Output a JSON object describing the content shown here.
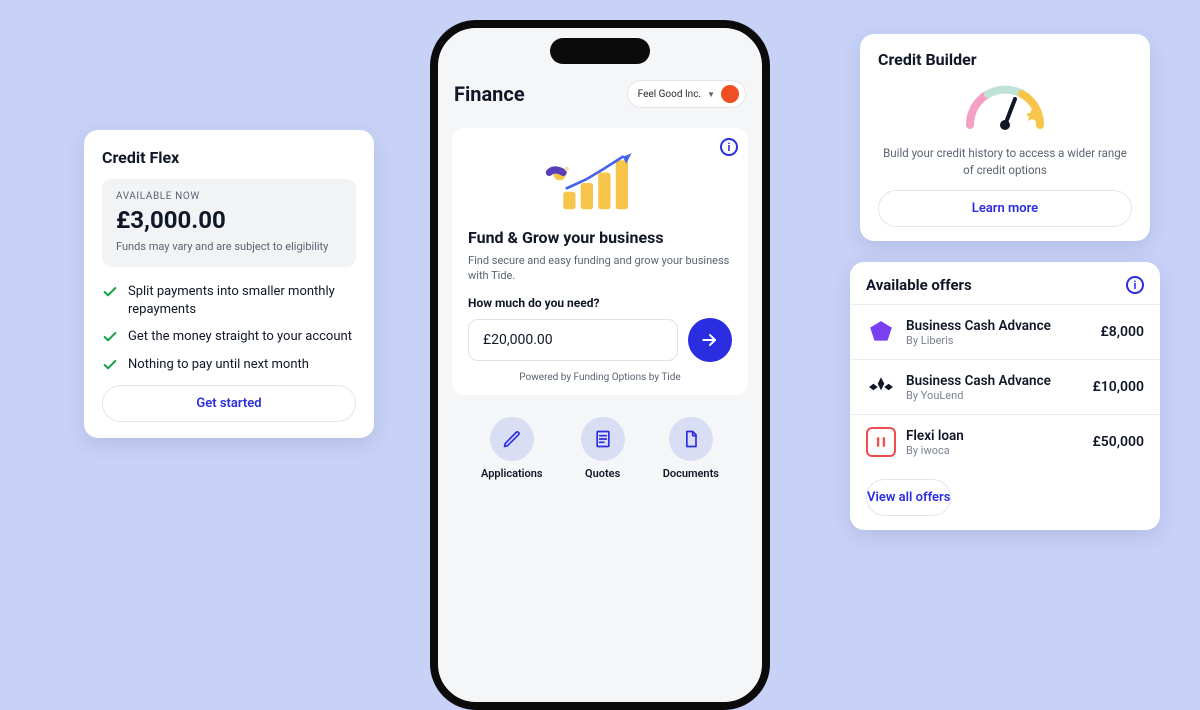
{
  "credit_flex": {
    "title": "Credit Flex",
    "available_label": "AVAILABLE NOW",
    "amount": "£3,000.00",
    "disclaimer": "Funds may vary and are subject to eligibility",
    "features": [
      "Split payments into smaller monthly repayments",
      "Get the money straight to your account",
      "Nothing to pay until next month"
    ],
    "cta": "Get started"
  },
  "phone": {
    "header_title": "Finance",
    "org_name": "Feel Good Inc.",
    "hero_title": "Fund & Grow your business",
    "hero_sub": "Find secure and easy funding and grow your business with Tide.",
    "question": "How much do you need?",
    "amount_value": "£20,000.00",
    "powered": "Powered by Funding Options by Tide",
    "actions": [
      {
        "label": "Applications",
        "icon": "pencil-icon"
      },
      {
        "label": "Quotes",
        "icon": "receipt-icon"
      },
      {
        "label": "Documents",
        "icon": "document-icon"
      }
    ]
  },
  "credit_builder": {
    "title": "Credit Builder",
    "desc": "Build your credit history to access a wider range of credit options",
    "cta": "Learn more"
  },
  "offers": {
    "title": "Available offers",
    "items": [
      {
        "name": "Business Cash Advance",
        "by": "By Liberis",
        "amount": "£8,000"
      },
      {
        "name": "Business Cash Advance",
        "by": "By YouLend",
        "amount": "£10,000"
      },
      {
        "name": "Flexi loan",
        "by": "By iwoca",
        "amount": "£50,000"
      }
    ],
    "cta": "View all offers"
  }
}
